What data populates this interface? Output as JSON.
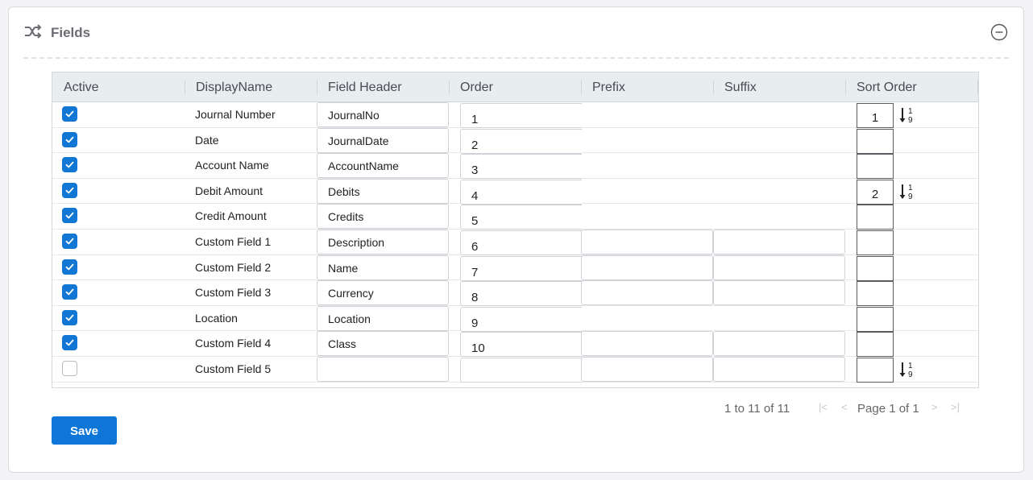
{
  "panel": {
    "title": "Fields",
    "icon": "shuffle-icon",
    "collapse_icon": "minus-circle-icon"
  },
  "columns": {
    "active": "Active",
    "display_name": "DisplayName",
    "field_header": "Field Header",
    "order": "Order",
    "prefix": "Prefix",
    "suffix": "Suffix",
    "sort_order": "Sort Order"
  },
  "rows": [
    {
      "active": true,
      "display_name": "Journal Number",
      "field_header": "JournalNo",
      "order": "1",
      "show_prefix_suffix": false,
      "sort_order": "1",
      "sort_icon": true
    },
    {
      "active": true,
      "display_name": "Date",
      "field_header": "JournalDate",
      "order": "2",
      "show_prefix_suffix": false,
      "sort_order": "",
      "sort_icon": false
    },
    {
      "active": true,
      "display_name": "Account Name",
      "field_header": "AccountName",
      "order": "3",
      "show_prefix_suffix": false,
      "sort_order": "",
      "sort_icon": false
    },
    {
      "active": true,
      "display_name": "Debit Amount",
      "field_header": "Debits",
      "order": "4",
      "show_prefix_suffix": false,
      "sort_order": "2",
      "sort_icon": true
    },
    {
      "active": true,
      "display_name": "Credit Amount",
      "field_header": "Credits",
      "order": "5",
      "show_prefix_suffix": false,
      "sort_order": "",
      "sort_icon": false
    },
    {
      "active": true,
      "display_name": "Custom Field 1",
      "field_header": "Description",
      "order": "6",
      "show_prefix_suffix": true,
      "sort_order": "",
      "sort_icon": false
    },
    {
      "active": true,
      "display_name": "Custom Field 2",
      "field_header": "Name",
      "order": "7",
      "show_prefix_suffix": true,
      "sort_order": "",
      "sort_icon": false
    },
    {
      "active": true,
      "display_name": "Custom Field 3",
      "field_header": "Currency",
      "order": "8",
      "show_prefix_suffix": true,
      "sort_order": "",
      "sort_icon": false
    },
    {
      "active": true,
      "display_name": "Location",
      "field_header": "Location",
      "order": "9",
      "show_prefix_suffix": false,
      "sort_order": "",
      "sort_icon": false
    },
    {
      "active": true,
      "display_name": "Custom Field 4",
      "field_header": "Class",
      "order": "10",
      "show_prefix_suffix": true,
      "sort_order": "",
      "sort_icon": false
    },
    {
      "active": false,
      "display_name": "Custom Field 5",
      "field_header": "",
      "order": "",
      "show_prefix_suffix": true,
      "sort_order": "",
      "sort_icon": true
    }
  ],
  "pager": {
    "count_text": "1 to 11 of 11",
    "page_text": "Page 1 of 1"
  },
  "save_label": "Save",
  "colors": {
    "accent": "#0e76d6",
    "header_bg": "#e8edf0"
  }
}
